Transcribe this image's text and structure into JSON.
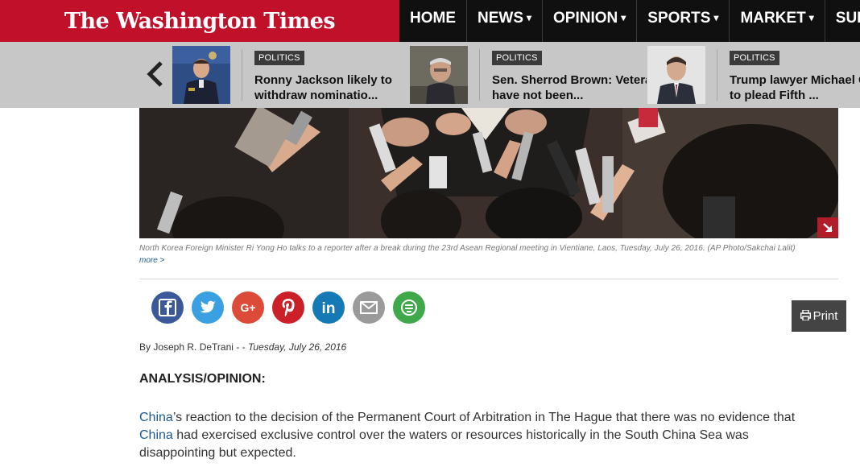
{
  "header": {
    "logo": "The Washington Times",
    "nav": [
      {
        "label": "HOME",
        "caret": false
      },
      {
        "label": "NEWS",
        "caret": true
      },
      {
        "label": "OPINION",
        "caret": true
      },
      {
        "label": "SPORTS",
        "caret": true
      },
      {
        "label": "MARKET",
        "caret": true
      },
      {
        "label": "SUB",
        "caret": false
      }
    ],
    "caret_glyph": "▾"
  },
  "trending": {
    "prev_icon": "chevron-left-icon",
    "cards": [
      {
        "badge": "POLITICS",
        "title_line1": "Ronny Jackson likely to",
        "title_line2": "withdraw nominatio..."
      },
      {
        "badge": "POLITICS",
        "title_line1": "Sen. Sherrod Brown: Veterans",
        "title_line2": "have not been..."
      },
      {
        "badge": "POLITICS",
        "title_line1": "Trump lawyer Michael Co",
        "title_line2": "to plead Fifth ..."
      }
    ]
  },
  "photo": {
    "expand_icon": "expand-arrow-icon",
    "caption": "North Korea Foreign Minister Ri Yong Ho talks to a reporter after a break during the 23rd Asean Regional meeting in Vientiane, Laos, Tuesday, July 26, 2016. (AP Photo/Sakchai Lalit)",
    "more": "more >"
  },
  "share": {
    "buttons": [
      {
        "icon": "facebook-icon",
        "color": "#3b5998"
      },
      {
        "icon": "twitter-icon",
        "color": "#3aa0e1"
      },
      {
        "icon": "google-plus-icon",
        "color": "#dc4a38"
      },
      {
        "icon": "pinterest-icon",
        "color": "#cb2027"
      },
      {
        "icon": "linkedin-icon",
        "color": "#1479b4"
      },
      {
        "icon": "email-icon",
        "color": "#9a9a9a"
      },
      {
        "icon": "more-share-icon",
        "color": "#3ea84a"
      }
    ],
    "print_label": "Print"
  },
  "article": {
    "byline_prefix": "By Joseph R. DeTrani - - ",
    "date": "Tuesday, July 26, 2016",
    "section": "ANALYSIS/OPINION:",
    "para_link1": "China",
    "para_text1": "’s reaction to the decision of the Permanent Court of Arbitration in The Hague that there was no evidence that",
    "para_link2": "China",
    "para_text2": " had exercised exclusive control over the waters or resources historically in the South China Sea was",
    "para_text3": "disappointing but expected."
  },
  "colors": {
    "brand_red": "#c0102a",
    "nav_bg": "#101010",
    "strip_bg": "#c7c7c7",
    "link_blue": "#1d5a8e"
  }
}
